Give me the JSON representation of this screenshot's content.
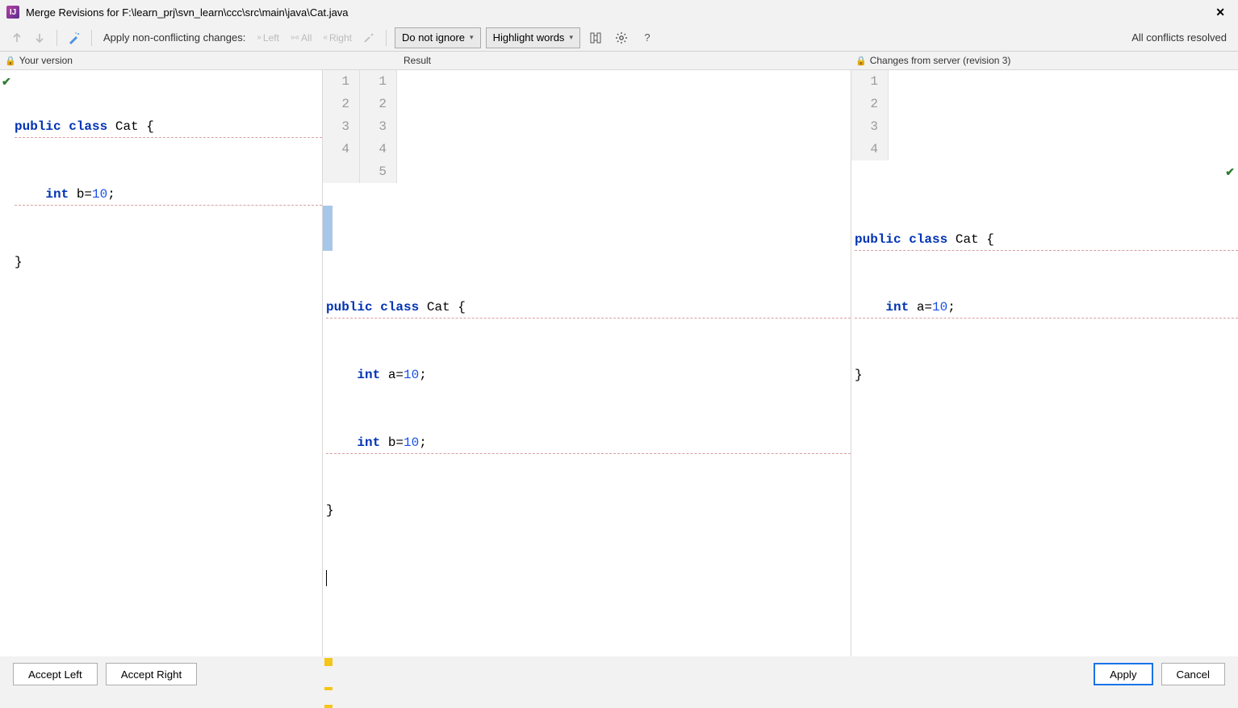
{
  "window": {
    "title": "Merge Revisions for F:\\learn_prj\\svn_learn\\ccc\\src\\main\\java\\Cat.java"
  },
  "toolbar": {
    "apply_nonconflicting_label": "Apply non-conflicting changes:",
    "left_btn": "Left",
    "all_btn": "All",
    "right_btn": "Right",
    "ignore_select": "Do not ignore",
    "highlight_select": "Highlight words",
    "status": "All conflicts resolved"
  },
  "headers": {
    "left": "Your version",
    "mid": "Result",
    "right": "Changes from server (revision 3)"
  },
  "left_code": {
    "line1": {
      "pre": "",
      "kw1": "public",
      "sp1": " ",
      "kw2": "class",
      "sp2": " ",
      "ident": "Cat",
      "tail": " {"
    },
    "line2": {
      "indent": "    ",
      "kw": "int",
      "sp": " ",
      "var": "b=",
      "num": "10",
      "tail": ";"
    },
    "line3": "}"
  },
  "mid_gutter_left": [
    "1",
    "2",
    "3",
    "4"
  ],
  "mid_gutter_right": [
    "1",
    "2",
    "3",
    "4",
    "5"
  ],
  "mid_code": {
    "line1": {
      "kw1": "public",
      "sp1": " ",
      "kw2": "class",
      "sp2": " ",
      "ident": "Cat",
      "tail": " {"
    },
    "line2": {
      "indent": "    ",
      "kw": "int",
      "sp": " ",
      "var": "a=",
      "num": "10",
      "tail": ";"
    },
    "line3": {
      "indent": "    ",
      "kw": "int",
      "sp": " ",
      "var": "b=",
      "num": "10",
      "tail": ";"
    },
    "line4": "}"
  },
  "right_gutter": [
    "1",
    "2",
    "3",
    "4"
  ],
  "right_code": {
    "line1": {
      "kw1": "public",
      "sp1": " ",
      "kw2": "class",
      "sp2": " ",
      "ident": "Cat",
      "tail": " {"
    },
    "line2": {
      "indent": "    ",
      "kw": "int",
      "sp": " ",
      "var": "a=",
      "num": "10",
      "tail": ";"
    },
    "line3": "}"
  },
  "footer": {
    "accept_left": "Accept Left",
    "accept_right": "Accept Right",
    "apply": "Apply",
    "cancel": "Cancel"
  }
}
